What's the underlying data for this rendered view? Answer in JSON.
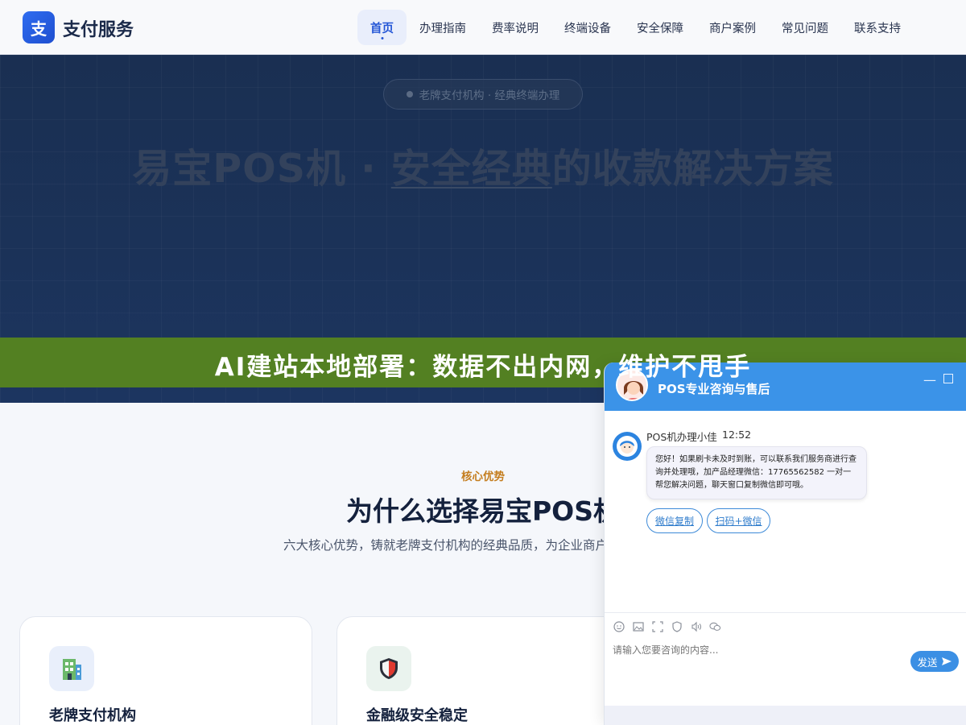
{
  "header": {
    "logo_char": "支",
    "logo_text": "支付服务",
    "nav": [
      {
        "label": "首页",
        "active": true
      },
      {
        "label": "办理指南"
      },
      {
        "label": "费率说明"
      },
      {
        "label": "终端设备"
      },
      {
        "label": "安全保障"
      },
      {
        "label": "商户案例"
      },
      {
        "label": "常见问题"
      },
      {
        "label": "联系支持"
      }
    ]
  },
  "hero": {
    "badge": "老牌支付机构 · 经典终端办理",
    "title_part1": "易宝POS机 · ",
    "title_highlight": "安全经典",
    "title_part2": "的收款解决方案"
  },
  "banner": {
    "text": "AI建站本地部署：数据不出内网，维护不甩手"
  },
  "section": {
    "tag": "核心优势",
    "title": "为什么选择易宝POS机",
    "desc": "六大核心优势，铸就老牌支付机构的经典品质，为企业商户提供终端服务",
    "cards": [
      {
        "title": "老牌支付机构",
        "icon": "building-icon"
      },
      {
        "title": "金融级安全稳定",
        "icon": "shield-icon"
      }
    ]
  },
  "chat": {
    "title": "POS专业咨询与售后",
    "agent_name": "POS机办理小佳",
    "time": "12:52",
    "message": "您好！如果刷卡未及时到账，可以联系我们服务商进行查询并处理哦，加产品经理微信：17765562582 一对一帮您解决问题，聊天窗口复制微信即可哦。",
    "chip1": "微信复制",
    "chip2": "扫码+微信",
    "input_placeholder": "请输入您要咨询的内容...",
    "send_label": "发送",
    "toolbar_icons": [
      "emoji-icon",
      "image-icon",
      "screenshot-icon",
      "evaluate-icon",
      "voice-icon",
      "wechat-icon"
    ]
  },
  "colors": {
    "brand": "#2f6df0",
    "hero_bg": "#1b3258",
    "banner_bg": "#538022",
    "chat_header": "#3b93e8",
    "section_tag": "#c47d1e"
  }
}
